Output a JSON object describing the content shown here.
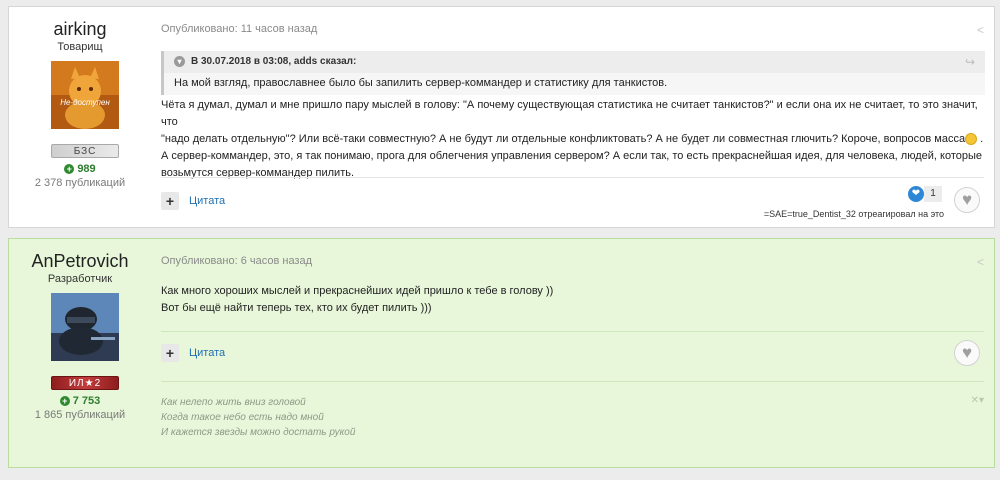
{
  "posts": [
    {
      "author": "airking",
      "rank": "Товарищ",
      "badge": "БЗС",
      "badge_color": "#d9d9d9",
      "reputation": "989",
      "publications": "2 378 публикаций",
      "meta": "Опубликовано: 11 часов назад",
      "quote": {
        "header": "В 30.07.2018 в 03:08, adds сказал:",
        "body": "На мой взгляд, православнее было бы запилить сервер-коммандер и статистику для танкистов."
      },
      "content": [
        "Чёта я думал, думал и мне пришло пару мыслей в голову: \"А почему существующая статистика не считает танкистов?\" и если она их не считает, то это значит, что",
        "\"надо делать отдельную\"? Или всё-таки совместную? А не будут ли отдельные конфликтовать? А не будет ли совместная глючить? Короче, вопросов масса",
        "А сервер-коммандер, это, я так понимаю, прога для облегчения управления сервером? А если так, то есть прекраснейшая идея, для человека, людей, которые",
        "возьмутся сервер-коммандер пилить."
      ],
      "content_line2_tail": " .",
      "quote_label": "Цитата",
      "reaction_count": "1",
      "reaction_text": "=SAE=true_Dentist_32 отреагировал на это"
    },
    {
      "author": "AnPetrovich",
      "rank": "Разработчик",
      "badge": "ИЛ★2",
      "badge_color": "#b52a2a",
      "reputation": "7 753",
      "publications": "1 865 публикаций",
      "meta": "Опубликовано: 6 часов назад",
      "content": [
        "Как много хороших мыслей и прекраснейших идей пришло к тебе в голову ))",
        "Вот бы ещё найти теперь тех, кто их будет пилить )))"
      ],
      "quote_label": "Цитата",
      "signature": [
        "Как нелепо жить вниз головой",
        "Когда такое небо есть надо мной",
        "И кажется звезды можно достать рукой"
      ]
    }
  ]
}
